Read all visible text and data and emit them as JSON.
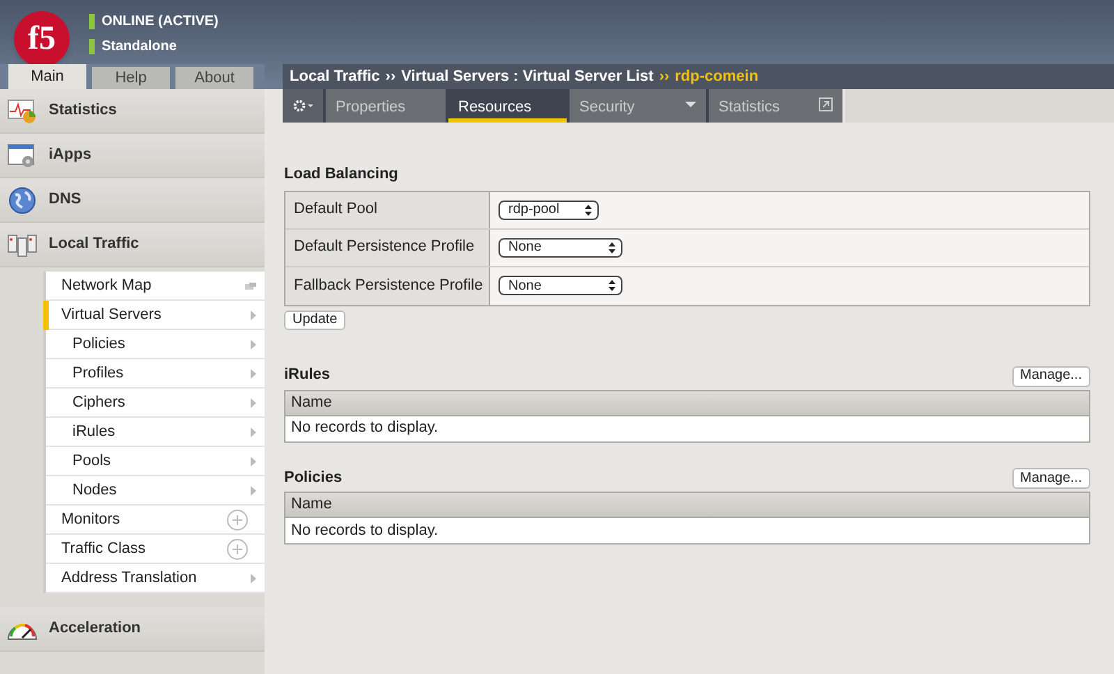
{
  "header": {
    "status": [
      {
        "text": "ONLINE (ACTIVE)",
        "color": "#8cc63f"
      },
      {
        "text": "Standalone",
        "color": "#8cc63f"
      }
    ],
    "logo": "f5"
  },
  "main_tabs": [
    {
      "label": "Main",
      "selected": true
    },
    {
      "label": "Help",
      "selected": false
    },
    {
      "label": "About",
      "selected": false
    }
  ],
  "sidebar": {
    "sections": [
      {
        "label": "Statistics",
        "kind": "chart"
      },
      {
        "label": "iApps",
        "kind": "window"
      },
      {
        "label": "DNS",
        "kind": "globe"
      },
      {
        "label": "Local Traffic",
        "kind": "servers",
        "items": [
          {
            "label": "Network Map",
            "kind": "map",
            "selected": false
          },
          {
            "label": "Virtual Servers",
            "kind": "arrow",
            "selected": true,
            "children": [
              {
                "label": "Policies",
                "kind": "arrow",
                "selected": false
              },
              {
                "label": "Profiles",
                "kind": "arrow",
                "selected": false
              },
              {
                "label": "Ciphers",
                "kind": "arrow",
                "selected": false
              },
              {
                "label": "iRules",
                "kind": "arrow",
                "selected": false
              },
              {
                "label": "Pools",
                "kind": "arrow",
                "selected": false
              },
              {
                "label": "Nodes",
                "kind": "arrow",
                "selected": false
              }
            ]
          },
          {
            "label": "Monitors",
            "kind": "add",
            "selected": false
          },
          {
            "label": "Traffic Class",
            "kind": "add",
            "selected": false
          },
          {
            "label": "Address Translation",
            "kind": "arrow",
            "selected": false
          }
        ]
      },
      {
        "label": "Acceleration",
        "kind": "gauge"
      }
    ]
  },
  "breadcrumb": {
    "parts": [
      "Local Traffic",
      "››",
      "Virtual Servers : Virtual Server List"
    ],
    "separator": "››",
    "current": "rdp-comein"
  },
  "tabs": [
    {
      "label": "Properties",
      "selected": false,
      "kind": "plain"
    },
    {
      "label": "Resources",
      "selected": true,
      "kind": "plain"
    },
    {
      "label": "Security",
      "selected": false,
      "kind": "menu"
    },
    {
      "label": "Statistics",
      "selected": false,
      "kind": "popout"
    }
  ],
  "load_balancing": {
    "title": "Load Balancing",
    "rows": [
      {
        "label": "Default Pool",
        "value": "rdp-pool"
      },
      {
        "label": "Default Persistence Profile",
        "value": "None"
      },
      {
        "label": "Fallback Persistence Profile",
        "value": "None"
      }
    ],
    "button": "Update"
  },
  "lists": [
    {
      "title": "iRules",
      "button": "Manage...",
      "column": "Name",
      "empty": "No records to display."
    },
    {
      "title": "Policies",
      "button": "Manage...",
      "column": "Name",
      "empty": "No records to display."
    }
  ]
}
